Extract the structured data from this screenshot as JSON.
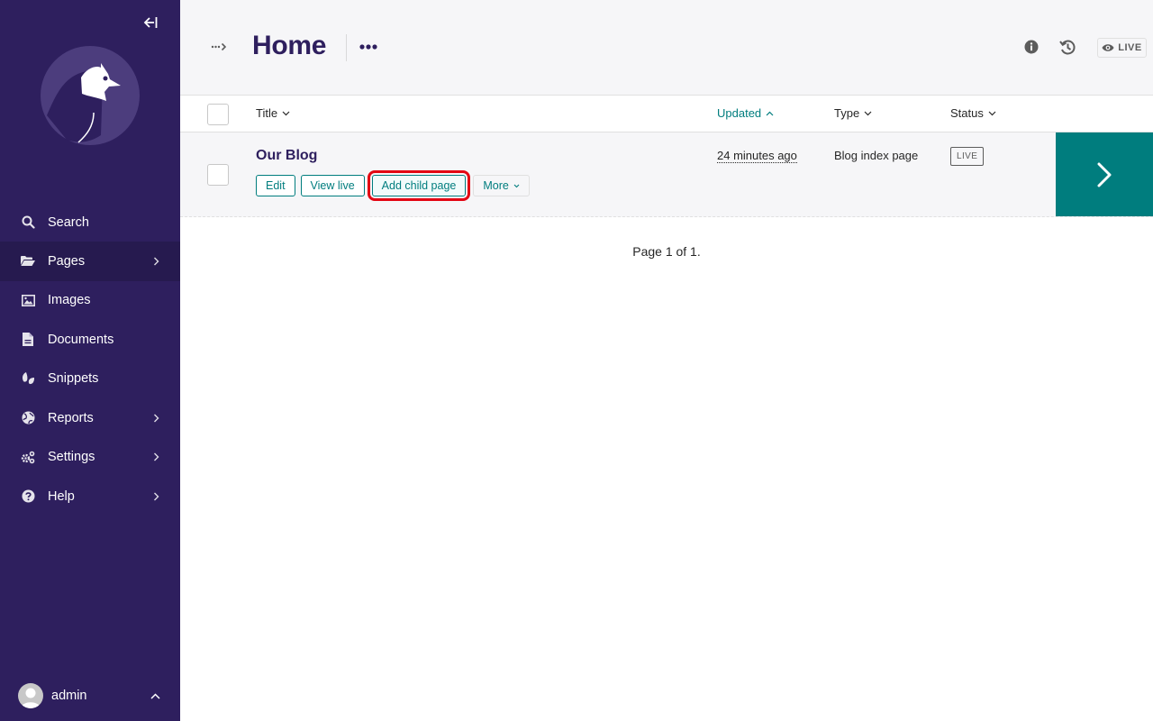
{
  "sidebar": {
    "collapse_label": "Toggle sidebar",
    "logo": "wagtail-bird-logo",
    "items": [
      {
        "label": "Search",
        "icon": "search-icon",
        "has_submenu": false,
        "active": false
      },
      {
        "label": "Pages",
        "icon": "folder-open-icon",
        "has_submenu": true,
        "active": true
      },
      {
        "label": "Images",
        "icon": "image-icon",
        "has_submenu": false,
        "active": false
      },
      {
        "label": "Documents",
        "icon": "document-icon",
        "has_submenu": false,
        "active": false
      },
      {
        "label": "Snippets",
        "icon": "snippet-leaf-icon",
        "has_submenu": false,
        "active": false
      },
      {
        "label": "Reports",
        "icon": "globe-icon",
        "has_submenu": true,
        "active": false
      },
      {
        "label": "Settings",
        "icon": "cogs-icon",
        "has_submenu": true,
        "active": false
      },
      {
        "label": "Help",
        "icon": "help-icon",
        "has_submenu": true,
        "active": false
      }
    ],
    "account": {
      "name": "admin"
    }
  },
  "header": {
    "title": "Home",
    "live_label": "LIVE"
  },
  "table": {
    "columns": [
      {
        "label": "Title",
        "sort": "none"
      },
      {
        "label": "Updated",
        "sort": "ascending"
      },
      {
        "label": "Type",
        "sort": "none"
      },
      {
        "label": "Status",
        "sort": "none"
      }
    ],
    "rows": [
      {
        "title": "Our Blog",
        "updated": "24 minutes ago",
        "type": "Blog index page",
        "status": "LIVE",
        "actions": [
          "Edit",
          "View live",
          "Add child page",
          "More"
        ],
        "highlighted_action": "Add child page"
      }
    ]
  },
  "pagination": {
    "text": "Page 1 of 1."
  },
  "colors": {
    "sidebar_bg": "#2e1f5e",
    "primary": "#2e1f5e",
    "accent_teal": "#007d7e",
    "highlight_red": "#e30613"
  }
}
